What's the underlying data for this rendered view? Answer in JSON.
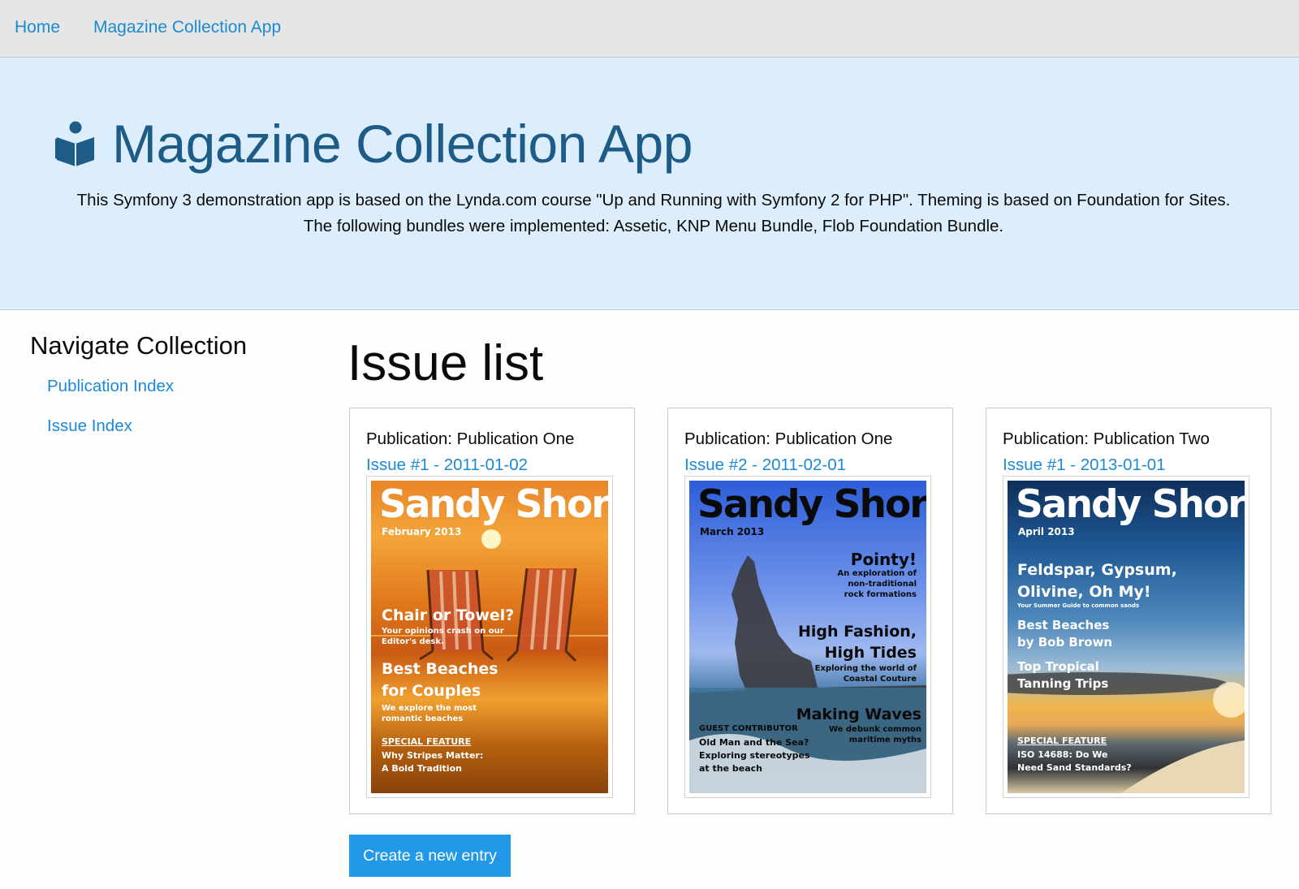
{
  "topbar": {
    "home": "Home",
    "app_link": "Magazine Collection App"
  },
  "hero": {
    "icon": "book-reader-icon",
    "title": "Magazine Collection App",
    "description": "This Symfony 3 demonstration app is based on the Lynda.com course \"Up and Running with Symfony 2 for PHP\". Theming is based on Foundation for Sites. The following bundles were implemented: Assetic, KNP Menu Bundle, Flob Foundation Bundle."
  },
  "sidebar": {
    "title": "Navigate Collection",
    "links": [
      "Publication Index",
      "Issue Index"
    ]
  },
  "main": {
    "title": "Issue list",
    "issues": [
      {
        "publication": "Publication: Publication One",
        "issue": "Issue #1 - 2011-01-02",
        "cover": {
          "masthead": "Sandy Shore",
          "month": "February 2013",
          "lines": [
            "Chair or Towel?",
            "Your opinions crash on our",
            "Editor's desk.",
            "Best Beaches",
            "for Couples",
            "We explore the most",
            "romantic beaches",
            "SPECIAL FEATURE",
            "Why Stripes Matter:",
            "A Bold Tradition"
          ]
        }
      },
      {
        "publication": "Publication: Publication One",
        "issue": "Issue #2 - 2011-02-01",
        "cover": {
          "masthead": "Sandy Shore",
          "month": "March 2013",
          "lines": [
            "Pointy!",
            "An exploration of",
            "non-traditional",
            "rock formations",
            "High Fashion,",
            "High Tides",
            "Exploring the world of",
            "Coastal Couture",
            "Making Waves",
            "We debunk common",
            "maritime myths",
            "GUEST CONTRIBUTOR",
            "Old Man and the Sea?",
            "Exploring stereotypes",
            "at the beach"
          ]
        }
      },
      {
        "publication": "Publication: Publication Two",
        "issue": "Issue #1 - 2013-01-01",
        "cover": {
          "masthead": "Sandy Shore",
          "month": "April 2013",
          "lines": [
            "Feldspar, Gypsum,",
            "Olivine, Oh My!",
            "Your Summer Guide to common sands",
            "Best Beaches",
            "by Bob Brown",
            "Top Tropical",
            "Tanning Trips",
            "SPECIAL FEATURE",
            "ISO 14688: Do We",
            "Need Sand Standards?"
          ]
        }
      }
    ],
    "create_button": "Create a new entry"
  },
  "colors": {
    "link": "#1a8ad4",
    "button": "#2199e8",
    "hero_bg": "#dcedfb",
    "hero_title": "#1d5c87",
    "topbar_bg": "#e6e6e6"
  }
}
